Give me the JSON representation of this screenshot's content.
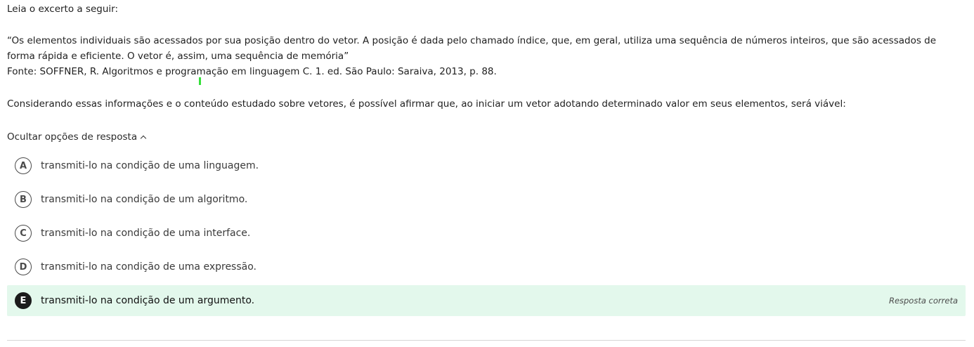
{
  "intro": "Leia o excerto a seguir:",
  "quote": "“Os elementos individuais são acessados por sua posição dentro do vetor. A posição é dada pelo chamado índice, que, em geral, utiliza uma sequência de números inteiros, que são acessados de forma rápida e eficiente. O vetor é, assim, uma sequência de memória”",
  "source": "Fonte: SOFFNER, R. Algoritmos e programação em linguagem C. 1. ed. São Paulo: Saraiva, 2013, p. 88.",
  "question": "Considerando essas informações e o conteúdo estudado sobre vetores, é possível afirmar que, ao iniciar um vetor adotando determinado valor em seus elementos, será viável:",
  "toggle_label": "Ocultar opções de resposta",
  "options": [
    {
      "letter": "A",
      "text": "transmiti-lo na condição de uma linguagem."
    },
    {
      "letter": "B",
      "text": "transmiti-lo na condição de um algoritmo."
    },
    {
      "letter": "C",
      "text": "transmiti-lo na condição de uma interface."
    },
    {
      "letter": "D",
      "text": "transmiti-lo na condição de uma expressão."
    },
    {
      "letter": "E",
      "text": "transmiti-lo na condição de um argumento.",
      "feedback": "Resposta correta"
    }
  ],
  "colors": {
    "correct_background": "#e3f8ec",
    "cursor_mark": "#35e03a"
  }
}
